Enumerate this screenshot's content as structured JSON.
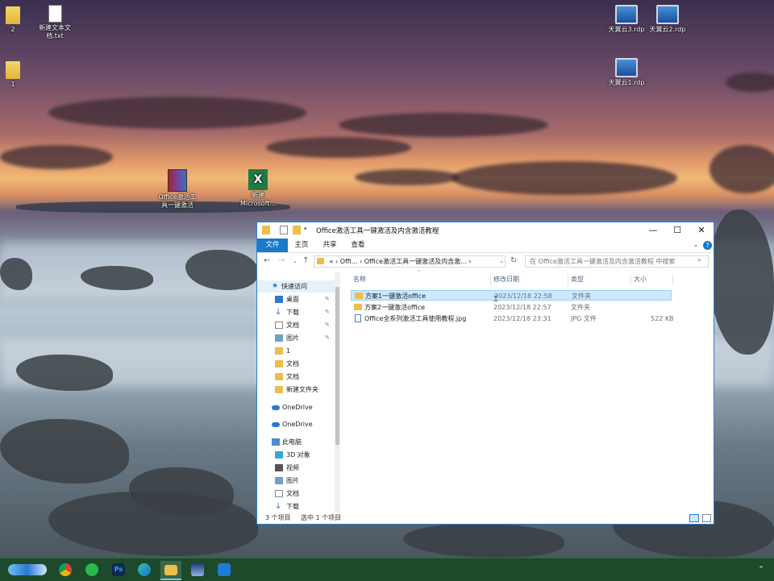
{
  "desktop": {
    "icons": [
      {
        "label": "2",
        "type": "folder"
      },
      {
        "label": "新建文本文档.txt",
        "type": "document"
      },
      {
        "label": "1",
        "type": "folder"
      },
      {
        "label": "天翼云3.rdp",
        "type": "rdp"
      },
      {
        "label": "天翼云2.rdp",
        "type": "rdp"
      },
      {
        "label": "天翼云1.rdp",
        "type": "rdp"
      },
      {
        "label": "Office激活工具一键激活",
        "type": "archive"
      },
      {
        "label": "新建 Microsoft...",
        "type": "excel"
      }
    ]
  },
  "explorer": {
    "title": "Office激活工具一键激活及内含激活教程",
    "controls": {
      "minimize": "—",
      "maximize": "☐",
      "close": "✕"
    },
    "ribbon_tabs": [
      "文件",
      "主页",
      "共享",
      "查看"
    ],
    "address": {
      "root": "«",
      "parts": [
        "Offi...",
        "Office激活工具一键激活及内含激..."
      ]
    },
    "search_placeholder": "在 Office激活工具一键激活及内含激活教程 中搜索",
    "nav": {
      "quick_access": "快速访问",
      "pinned": [
        {
          "label": "桌面",
          "icon": "desktop-icon"
        },
        {
          "label": "下载",
          "icon": "download-icon"
        },
        {
          "label": "文档",
          "icon": "document-icon"
        },
        {
          "label": "图片",
          "icon": "picture-icon"
        }
      ],
      "folders": [
        "1",
        "文档",
        "文档",
        "新建文件夹"
      ],
      "onedrive": [
        "OneDrive",
        "OneDrive"
      ],
      "this_pc": "此电脑",
      "pc_items": [
        {
          "label": "3D 对象",
          "icon": "3d-objects-icon"
        },
        {
          "label": "视频",
          "icon": "video-icon"
        },
        {
          "label": "图片",
          "icon": "picture-icon"
        },
        {
          "label": "文档",
          "icon": "document-icon"
        },
        {
          "label": "下载",
          "icon": "download-icon"
        }
      ]
    },
    "columns": {
      "name": "名称",
      "modified": "修改日期",
      "type": "类型",
      "size": "大小"
    },
    "files": [
      {
        "name": "方案1一键激活office",
        "modified": "2023/12/18 22:58",
        "type": "文件夹",
        "size": "",
        "selected": true
      },
      {
        "name": "方案2一键激活office",
        "modified": "2023/12/18 22:57",
        "type": "文件夹",
        "size": "",
        "selected": false
      },
      {
        "name": "Office全系列激活工具使用教程.jpg",
        "modified": "2023/12/18 23:31",
        "type": "JPG 文件",
        "size": "522 KB",
        "selected": false
      }
    ],
    "status": {
      "count": "3 个项目",
      "selected": "选中 1 个项目"
    }
  },
  "taskbar": {
    "apps": [
      "start-icon",
      "chrome-icon",
      "wechat-icon",
      "photoshop-icon",
      "edge-icon",
      "file-explorer-icon",
      "photos-icon",
      "screen-recorder-icon"
    ]
  },
  "colors": {
    "accent": "#1979ca",
    "selection": "#cce8ff",
    "taskbar": "#1c4a2a"
  }
}
